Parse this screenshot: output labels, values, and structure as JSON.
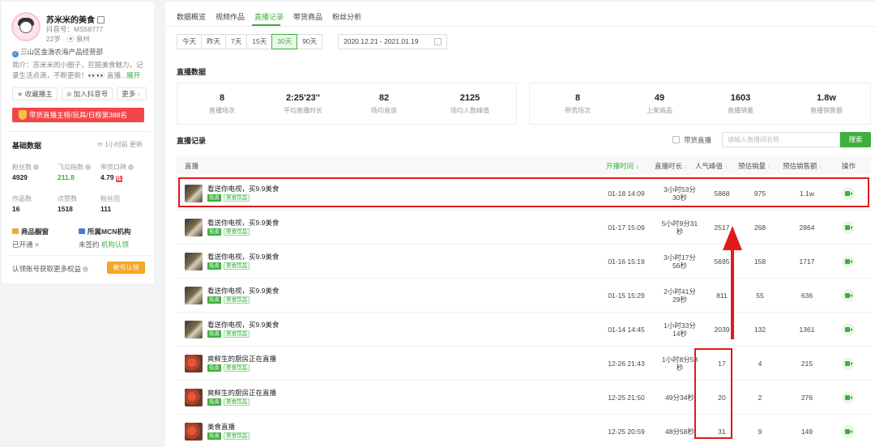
{
  "profile": {
    "name": "苏米米的美食",
    "douyin_id": "抖音号：MS58777",
    "age": "22岁",
    "location": "泉州",
    "verified": "三山区金渔农海产品经营部",
    "bio": "简介：苏米米的小圈子，挖掘美食魅力，记录生活点滴，不断更新！👀👀 直播...",
    "bio_more": "展开",
    "buttons": {
      "collect": "收藏播主",
      "add": "加入抖音号",
      "more": "更多"
    },
    "rank_banner": "带货直播主榜/玩具/日榜第388名"
  },
  "basic": {
    "title": "基础数据",
    "updated": "1小时前 更新",
    "stats": [
      {
        "label": "粉丝数",
        "value": "4929"
      },
      {
        "label": "飞瓜指数",
        "value": "211.8"
      },
      {
        "label": "带货口碑",
        "value": "4.79",
        "badge": "低"
      },
      {
        "label": "作品数",
        "value": "16"
      },
      {
        "label": "点赞数",
        "value": "1518"
      },
      {
        "label": "粉丝团",
        "value": "111"
      }
    ],
    "shop_window": "商品橱窗",
    "mcn": "所属MCN机构",
    "shop_status": "已开通 >",
    "mcn_status": "未签约",
    "mcn_link": "机构认领",
    "claim_text": "认领账号获取更多权益",
    "claim_button": "帐号认领"
  },
  "tabs": [
    "数据概览",
    "视频作品",
    "直播记录",
    "带货商品",
    "粉丝分析"
  ],
  "active_tab": "直播记录",
  "ranges": [
    "今天",
    "昨天",
    "7天",
    "15天",
    "30天",
    "90天"
  ],
  "active_range": "30天",
  "date_range": "2020.12.21 - 2021.01.19",
  "live_data": {
    "title": "直播数据",
    "card1": [
      {
        "value": "8",
        "label": "直播场次"
      },
      {
        "value": "2:25'23''",
        "label": "平均直播时长"
      },
      {
        "value": "82",
        "label": "场均音浪"
      },
      {
        "value": "2125",
        "label": "场均人数峰值"
      }
    ],
    "card2": [
      {
        "value": "8",
        "label": "带货场次"
      },
      {
        "value": "49",
        "label": "上架商品"
      },
      {
        "value": "1603",
        "label": "直播销量"
      },
      {
        "value": "1.8w",
        "label": "直播销售额"
      }
    ]
  },
  "records": {
    "title": "直播记录",
    "filter_label": "带货直播",
    "search_placeholder": "请输入直播间名称",
    "search_button": "搜索",
    "headers": {
      "live": "直播",
      "start": "开播时间",
      "duration": "直播时长",
      "peak": "人气峰值",
      "sales": "预估销量",
      "amount": "预估销售额",
      "op": "操作"
    },
    "rows": [
      {
        "title": "看送你电视，买9.9美食",
        "tag1": "热卖",
        "tag2": "美食饮品",
        "time": "01-18 14:09",
        "dur1": "3小时53分",
        "dur2": "30秒",
        "peak": "5868",
        "sales": "975",
        "amount": "1.1w"
      },
      {
        "title": "看送你电视，买9.9美食",
        "tag1": "热卖",
        "tag2": "美食饮品",
        "time": "01-17 15:09",
        "dur1": "5小时9分31",
        "dur2": "秒",
        "peak": "2517",
        "sales": "268",
        "amount": "2864"
      },
      {
        "title": "看送你电视，买9.9美食",
        "tag1": "热卖",
        "tag2": "美食饮品",
        "time": "01-16 15:19",
        "dur1": "3小时17分",
        "dur2": "56秒",
        "peak": "5695",
        "sales": "158",
        "amount": "1717"
      },
      {
        "title": "看送你电视，买9.9美食",
        "tag1": "热卖",
        "tag2": "美食饮品",
        "time": "01-15 15:29",
        "dur1": "2小时41分",
        "dur2": "29秒",
        "peak": "811",
        "sales": "55",
        "amount": "636"
      },
      {
        "title": "看送你电视，买9.9美食",
        "tag1": "热卖",
        "tag2": "美食饮品",
        "time": "01-14 14:45",
        "dur1": "1小时33分",
        "dur2": "14秒",
        "peak": "2039",
        "sales": "132",
        "amount": "1361"
      },
      {
        "title": "爽鲜生的厨房正在直播",
        "tag1": "热卖",
        "tag2": "美食饮品",
        "time": "12-26 21:43",
        "dur1": "1小时8分58",
        "dur2": "秒",
        "peak": "17",
        "sales": "4",
        "amount": "215"
      },
      {
        "title": "爽鲜生的厨房正在直播",
        "tag1": "热卖",
        "tag2": "美食饮品",
        "time": "12-25 21:50",
        "dur1": "49分34秒",
        "dur2": "",
        "peak": "20",
        "sales": "2",
        "amount": "276"
      },
      {
        "title": "美食直播",
        "tag1": "热卖",
        "tag2": "美食饮品",
        "time": "12-25 20:59",
        "dur1": "48分58秒",
        "dur2": "",
        "peak": "31",
        "sales": "9",
        "amount": "149"
      }
    ]
  }
}
